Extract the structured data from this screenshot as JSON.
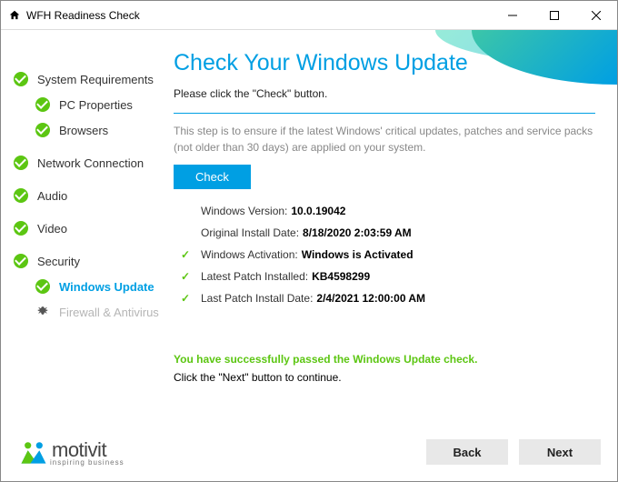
{
  "window": {
    "title": "WFH Readiness Check"
  },
  "sidebar": {
    "items": [
      {
        "label": "System Requirements"
      },
      {
        "label": "PC Properties"
      },
      {
        "label": "Browsers"
      },
      {
        "label": "Network Connection"
      },
      {
        "label": "Audio"
      },
      {
        "label": "Video"
      },
      {
        "label": "Security"
      },
      {
        "label": "Windows Update"
      },
      {
        "label": "Firewall & Antivirus"
      }
    ]
  },
  "main": {
    "heading": "Check Your Windows Update",
    "instruction": "Please click the \"Check\" button.",
    "description": "This step is to ensure if the latest Windows' critical updates, patches and service packs (not older than 30 days) are applied on your system.",
    "check_button": "Check",
    "rows": [
      {
        "tick": false,
        "label": "Windows Version:",
        "value": "10.0.19042"
      },
      {
        "tick": false,
        "label": "Original Install Date:",
        "value": "8/18/2020 2:03:59 AM"
      },
      {
        "tick": true,
        "label": "Windows Activation:",
        "value": "Windows is Activated"
      },
      {
        "tick": true,
        "label": "Latest Patch Installed:",
        "value": "KB4598299"
      },
      {
        "tick": true,
        "label": "Last Patch Install Date:",
        "value": "2/4/2021 12:00:00 AM"
      }
    ],
    "success": "You have successfully passed the Windows Update check.",
    "next_instruction": "Click the \"Next\" button to continue."
  },
  "footer": {
    "brand": "motivit",
    "tagline": "inspiring business",
    "back": "Back",
    "next": "Next"
  }
}
